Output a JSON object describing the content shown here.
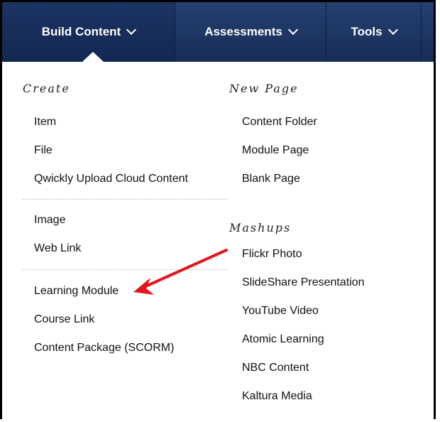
{
  "menubar": {
    "tabs": [
      {
        "label": "Build Content"
      },
      {
        "label": "Assessments"
      },
      {
        "label": "Tools"
      }
    ]
  },
  "create": {
    "heading": "Create",
    "group1": [
      "Item",
      "File",
      "Qwickly Upload Cloud Content"
    ],
    "group2": [
      "Image",
      "Web Link"
    ],
    "group3": [
      "Learning Module",
      "Course Link",
      "Content Package (SCORM)"
    ]
  },
  "new_page": {
    "heading": "New Page",
    "items": [
      "Content Folder",
      "Module Page",
      "Blank Page"
    ]
  },
  "mashups": {
    "heading": "Mashups",
    "items": [
      "Flickr Photo",
      "SlideShare Presentation",
      "YouTube Video",
      "Atomic Learning",
      "NBC Content",
      "Kaltura Media"
    ]
  },
  "annotation": {
    "color": "#e5141b"
  }
}
